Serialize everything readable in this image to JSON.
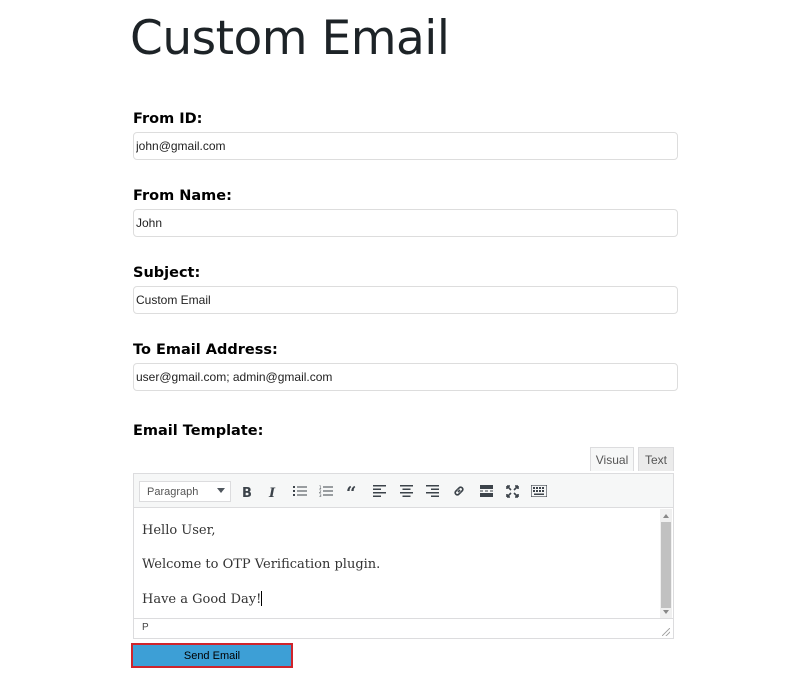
{
  "page": {
    "title": "Custom Email"
  },
  "form": {
    "from_id": {
      "label": "From ID:",
      "value": "john@gmail.com"
    },
    "from_name": {
      "label": "From Name:",
      "value": "John"
    },
    "subject": {
      "label": "Subject:",
      "value": "Custom Email"
    },
    "to_address": {
      "label": "To Email Address:",
      "value": "user@gmail.com; admin@gmail.com"
    },
    "template": {
      "label": "Email Template:"
    }
  },
  "editor": {
    "tabs": {
      "visual": "Visual",
      "text": "Text"
    },
    "format_select": "Paragraph",
    "toolbar_icons": [
      "bold-icon",
      "italic-icon",
      "bullet-list-icon",
      "numbered-list-icon",
      "blockquote-icon",
      "align-left-icon",
      "align-center-icon",
      "align-right-icon",
      "link-icon",
      "read-more-icon",
      "fullscreen-icon",
      "toolbar-toggle-icon"
    ],
    "content": [
      "Hello User,",
      "Welcome to OTP Verification plugin.",
      "Have a Good Day!"
    ],
    "status_path": "P"
  },
  "actions": {
    "send_label": "Send Email"
  },
  "colors": {
    "send_button_bg": "#3d9fd6",
    "send_button_border": "#d0242b"
  }
}
